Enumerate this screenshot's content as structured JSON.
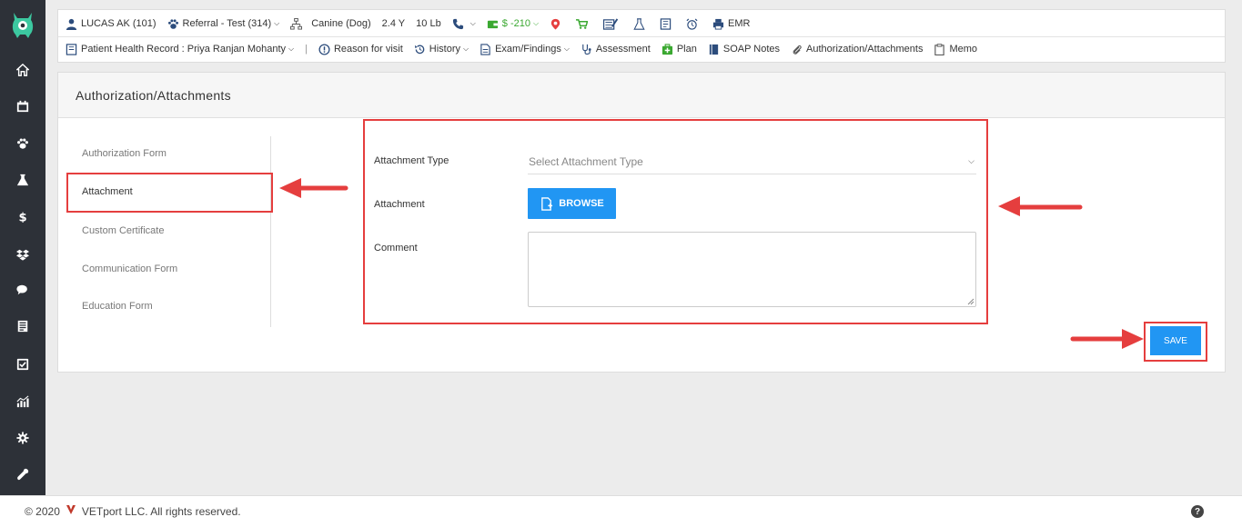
{
  "header": {
    "patient": "LUCAS AK (101)",
    "referral": "Referral - Test (314)",
    "species": "Canine (Dog)",
    "age": "2.4 Y",
    "weight": "10 Lb",
    "balance": "$ -210",
    "emr": "EMR",
    "record": "Patient Health Record : Priya Ranjan Mohanty",
    "nav": {
      "reason": "Reason for visit",
      "history": "History",
      "exam": "Exam/Findings",
      "assessment": "Assessment",
      "plan": "Plan",
      "soap": "SOAP Notes",
      "auth": "Authorization/Attachments",
      "memo": "Memo"
    }
  },
  "page": {
    "title": "Authorization/Attachments"
  },
  "menu": {
    "items": [
      "Authorization Form",
      "Attachment",
      "Custom Certificate",
      "Communication Form",
      "Education Form"
    ]
  },
  "form": {
    "type_label": "Attachment Type",
    "type_placeholder": "Select Attachment Type",
    "attachment_label": "Attachment",
    "browse_label": "BROWSE",
    "comment_label": "Comment",
    "save_label": "SAVE"
  },
  "footer": {
    "copyright": "© 2020",
    "company": "VETport LLC. All rights reserved.",
    "help": "?"
  },
  "colors": {
    "sidebar": "#2d3138",
    "accent": "#2196f3",
    "annotation": "#e53e3e",
    "balance": "#3aa830"
  }
}
